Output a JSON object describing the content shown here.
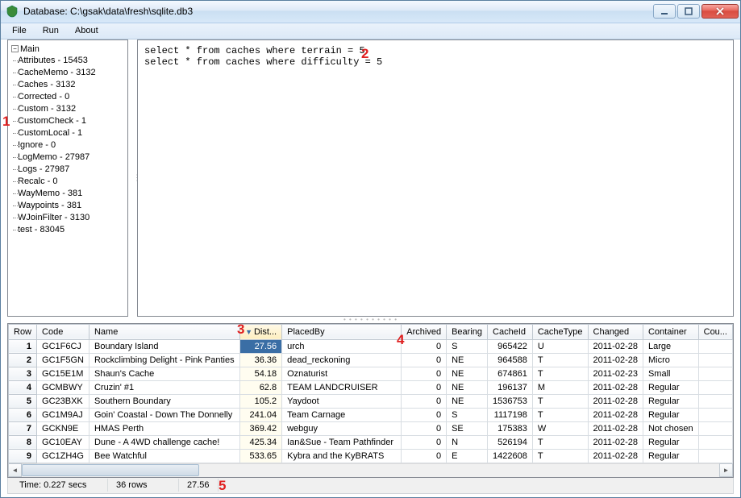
{
  "title": "Database: C:\\gsak\\data\\fresh\\sqlite.db3",
  "menu": {
    "file": "File",
    "run": "Run",
    "about": "About"
  },
  "tree": {
    "root": "Main",
    "items": [
      "Attributes - 15453",
      "CacheMemo - 3132",
      "Caches - 3132",
      "Corrected - 0",
      "Custom - 3132",
      "CustomCheck - 1",
      "CustomLocal - 1",
      "Ignore - 0",
      "LogMemo - 27987",
      "Logs - 27987",
      "Recalc - 0",
      "WayMemo - 381",
      "Waypoints - 381",
      "WJoinFilter - 3130",
      "test - 83045"
    ]
  },
  "sql": "select * from caches where terrain = 5\nselect * from caches where difficulty = 5",
  "columns": {
    "row": "Row",
    "code": "Code",
    "name": "Name",
    "dist": "Dist...",
    "placedby": "PlacedBy",
    "archived": "Archived",
    "bearing": "Bearing",
    "cacheid": "CacheId",
    "cachetype": "CacheType",
    "changed": "Changed",
    "container": "Container",
    "cou": "Cou..."
  },
  "rows": [
    {
      "n": 1,
      "code": "GC1F6CJ",
      "name": "Boundary Island",
      "dist": "27.56",
      "placedby": "urch",
      "archived": "0",
      "bearing": "S",
      "cacheid": "965422",
      "cachetype": "U",
      "changed": "2011-02-28",
      "container": "Large"
    },
    {
      "n": 2,
      "code": "GC1F5GN",
      "name": "Rockclimbing Delight - Pink Panties",
      "dist": "36.36",
      "placedby": "dead_reckoning",
      "archived": "0",
      "bearing": "NE",
      "cacheid": "964588",
      "cachetype": "T",
      "changed": "2011-02-28",
      "container": "Micro"
    },
    {
      "n": 3,
      "code": "GC15E1M",
      "name": "Shaun's Cache",
      "dist": "54.18",
      "placedby": "Oznaturist",
      "archived": "0",
      "bearing": "NE",
      "cacheid": "674861",
      "cachetype": "T",
      "changed": "2011-02-23",
      "container": "Small"
    },
    {
      "n": 4,
      "code": "GCMBWY",
      "name": "Cruzin' #1",
      "dist": "62.8",
      "placedby": "TEAM LANDCRUISER",
      "archived": "0",
      "bearing": "NE",
      "cacheid": "196137",
      "cachetype": "M",
      "changed": "2011-02-28",
      "container": "Regular"
    },
    {
      "n": 5,
      "code": "GC23BXK",
      "name": "Southern Boundary",
      "dist": "105.2",
      "placedby": "Yaydoot",
      "archived": "0",
      "bearing": "NE",
      "cacheid": "1536753",
      "cachetype": "T",
      "changed": "2011-02-28",
      "container": "Regular"
    },
    {
      "n": 6,
      "code": "GC1M9AJ",
      "name": "Goin' Coastal - Down The Donnelly",
      "dist": "241.04",
      "placedby": "Team Carnage",
      "archived": "0",
      "bearing": "S",
      "cacheid": "1117198",
      "cachetype": "T",
      "changed": "2011-02-28",
      "container": "Regular"
    },
    {
      "n": 7,
      "code": "GCKN9E",
      "name": "HMAS Perth",
      "dist": "369.42",
      "placedby": "webguy",
      "archived": "0",
      "bearing": "SE",
      "cacheid": "175383",
      "cachetype": "W",
      "changed": "2011-02-28",
      "container": "Not chosen"
    },
    {
      "n": 8,
      "code": "GC10EAY",
      "name": "Dune - A 4WD challenge cache!",
      "dist": "425.34",
      "placedby": "Ian&Sue - Team Pathfinder",
      "archived": "0",
      "bearing": "N",
      "cacheid": "526194",
      "cachetype": "T",
      "changed": "2011-02-28",
      "container": "Regular"
    },
    {
      "n": 9,
      "code": "GC1ZH4G",
      "name": "Bee Watchful",
      "dist": "533.65",
      "placedby": "Kybra and the KyBRATS",
      "archived": "0",
      "bearing": "E",
      "cacheid": "1422608",
      "cachetype": "T",
      "changed": "2011-02-28",
      "container": "Regular"
    }
  ],
  "status": {
    "time": "Time: 0.227 secs",
    "rows": "36 rows",
    "val": "27.56"
  },
  "annotations": {
    "a1": "1",
    "a2": "2",
    "a3": "3",
    "a4": "4",
    "a5": "5"
  }
}
